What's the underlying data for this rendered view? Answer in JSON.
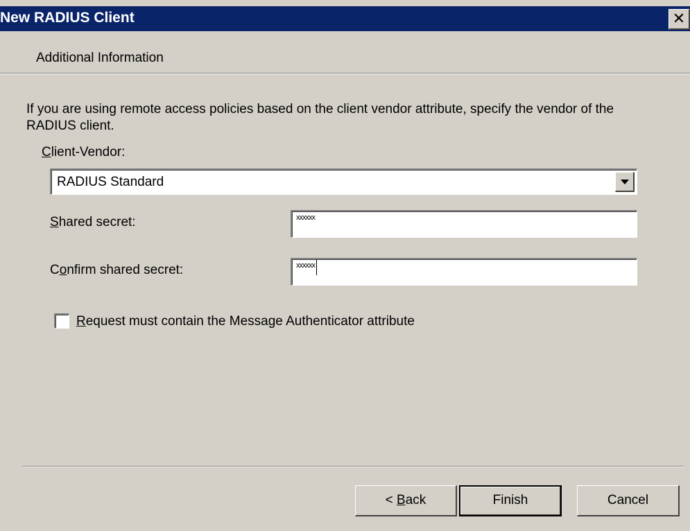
{
  "window": {
    "title": "New RADIUS Client",
    "close_glyph": "✕"
  },
  "page": {
    "header": "Additional Information",
    "description": "If you are using remote access policies based on the client vendor attribute, specify the vendor of the RADIUS client."
  },
  "form": {
    "client_vendor": {
      "label_mnemonic": "C",
      "label_rest": "lient-Vendor:",
      "value": "RADIUS Standard"
    },
    "shared_secret": {
      "label_mnemonic": "S",
      "label_rest": "hared secret:",
      "value": "xxxxxx"
    },
    "confirm_secret": {
      "label_before": "C",
      "label_mnemonic": "o",
      "label_after": "nfirm shared secret:",
      "value": "xxxxxx"
    },
    "message_authenticator": {
      "label_mnemonic": "R",
      "label_rest": "equest must contain the Message Authenticator attribute",
      "checked": false
    }
  },
  "buttons": {
    "back_prefix": "< ",
    "back_mnemonic": "B",
    "back_rest": "ack",
    "finish": "Finish",
    "cancel": "Cancel"
  },
  "colors": {
    "titlebar": "#0a246a",
    "dialog_face": "#d4d0c8"
  },
  "icons": {
    "close": "close-icon",
    "dropdown": "chevron-down-icon"
  }
}
